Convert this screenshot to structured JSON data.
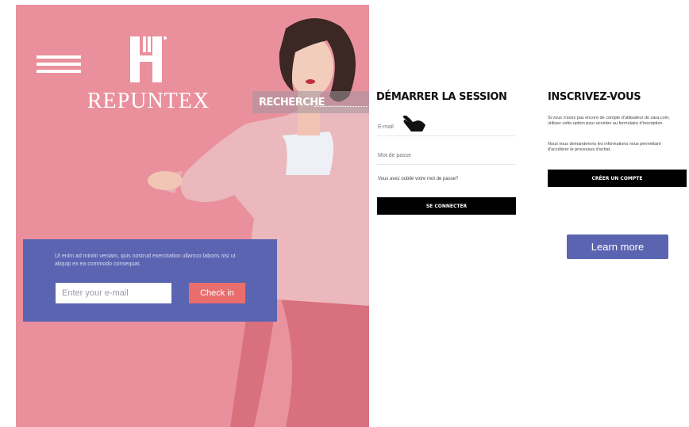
{
  "brand": {
    "name": "REPUNTEX"
  },
  "nav": {
    "search_label": "RECHERCHE"
  },
  "promo": {
    "text": "Ut enim ad minim veniam, quis nostrud exercitation ullamco laboris nisi ut aliquip ex ea commodo consequat.",
    "email_placeholder": "Enter your e-mail",
    "checkin_label": "Check in"
  },
  "login": {
    "title": "DÉMARRER LA SESSION",
    "email_label": "E-mail",
    "password_label": "Mot de passe",
    "forgot_link": "Vous avez oublié votre mot de passe?",
    "submit_label": "SE CONNECTER"
  },
  "register": {
    "title": "INSCRIVEZ-VOUS",
    "text1": "Si vous n'avez pas encore de compte d'utilisateur de zara.com, utilisez cette option pour accéder au formulaire d'inscription.",
    "text2": "Nous vous demanderons les informations nous permettant d'accélérer le processus d'achat.",
    "create_label": "CRÉER UN COMPTE"
  },
  "cta": {
    "learn_more_label": "Learn more"
  },
  "colors": {
    "hero_pink": "#e98a98",
    "promo_blue": "#5b64b1",
    "checkin_red": "#ea6d6d",
    "button_black": "#000000"
  },
  "icons": {
    "menu": "hamburger-menu-icon",
    "logo": "brand-logo-icon",
    "pointer": "hand-pointer-icon"
  }
}
